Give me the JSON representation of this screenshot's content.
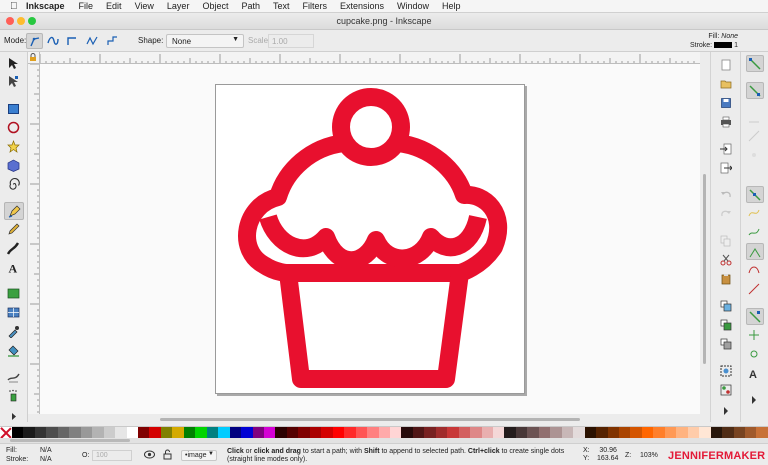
{
  "menubar": {
    "app_name": "Inkscape",
    "items": [
      "File",
      "Edit",
      "View",
      "Layer",
      "Object",
      "Path",
      "Text",
      "Filters",
      "Extensions",
      "Window",
      "Help"
    ]
  },
  "window": {
    "title": "cupcake.png - Inkscape"
  },
  "tool_controls": {
    "mode_label": "Mode:",
    "shape_label": "Shape:",
    "shape_value": "None",
    "scale_label": "Scale:",
    "scale_value": "1.00",
    "fill_label": "Fill:",
    "fill_value": "None",
    "stroke_label": "Stroke:",
    "stroke_width": "1"
  },
  "cupcake": {
    "color": "#e8102e"
  },
  "palette": {
    "colors": [
      "#000000",
      "#1a1a1a",
      "#333333",
      "#4d4d4d",
      "#666666",
      "#808080",
      "#999999",
      "#b3b3b3",
      "#cccccc",
      "#e6e6e6",
      "#ffffff",
      "#800000",
      "#d40000",
      "#808000",
      "#d4aa00",
      "#008000",
      "#00d400",
      "#008080",
      "#00ccff",
      "#000080",
      "#0000d4",
      "#800080",
      "#d400d4",
      "#2b0000",
      "#550000",
      "#800000",
      "#aa0000",
      "#d40000",
      "#ff0000",
      "#ff2a2a",
      "#ff5555",
      "#ff8080",
      "#ffaaaa",
      "#ffd5d5",
      "#280b0b",
      "#501616",
      "#782121",
      "#a02c2c",
      "#c83737",
      "#d35f5f",
      "#de8787",
      "#e9afaf",
      "#f4d7d7",
      "#241c1c",
      "#483737",
      "#6c5353",
      "#916f6f",
      "#ac9393",
      "#c8b7b7",
      "#e3dbdb",
      "#2b1100",
      "#552200",
      "#803300",
      "#aa4400",
      "#d45500",
      "#ff6600",
      "#ff7f2a",
      "#ff9955",
      "#ffb380",
      "#ffccaa",
      "#ffe6d5",
      "#28170b",
      "#502d16",
      "#784421",
      "#a05a2c",
      "#c87137"
    ]
  },
  "status": {
    "fill_label": "Fill:",
    "fill_value": "N/A",
    "stroke_label": "Stroke:",
    "stroke_value": "N/A",
    "opacity_label": "O:",
    "opacity_value": "100",
    "layer_value": "•image",
    "message": {
      "p1": "Click",
      "p2": " or ",
      "p3": "click and drag",
      "p4": " to start a path; with ",
      "p5": "Shift",
      "p6": " to append to selected path. ",
      "p7": "Ctrl+click",
      "p8": " to create single dots (straight line modes only)."
    },
    "x_label": "X:",
    "x_value": "30.96",
    "y_label": "Y:",
    "y_value": "163.64",
    "z_label": "Z:",
    "zoom_value": "103%"
  },
  "branding": {
    "text": "JENNIFERMAKER"
  }
}
